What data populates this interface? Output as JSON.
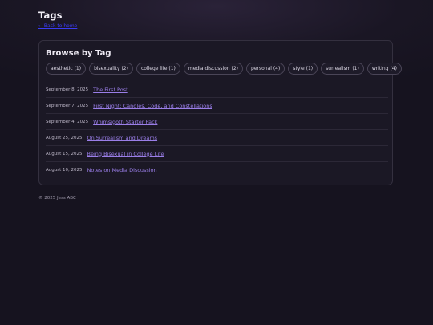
{
  "header": {
    "title": "Tags",
    "back_link": "← Back to home"
  },
  "browse": {
    "title": "Browse by Tag",
    "tags": [
      {
        "label": "aesthetic (1)"
      },
      {
        "label": "bisexuality (2)"
      },
      {
        "label": "college life (1)"
      },
      {
        "label": "media discussion (2)"
      },
      {
        "label": "personal (4)"
      },
      {
        "label": "style (1)"
      },
      {
        "label": "surrealism (1)"
      },
      {
        "label": "writing (4)"
      }
    ],
    "posts": [
      {
        "date": "September 8, 2025",
        "title": "The First Post"
      },
      {
        "date": "September 7, 2025",
        "title": "First Night: Candles, Code, and Constellations"
      },
      {
        "date": "September 4, 2025",
        "title": "Whimsigoth Starter Pack"
      },
      {
        "date": "August 25, 2025",
        "title": "On Surrealism and Dreams"
      },
      {
        "date": "August 15, 2025",
        "title": "Being Bisexual in College Life"
      },
      {
        "date": "August 10, 2025",
        "title": "Notes on Media Discussion"
      }
    ]
  },
  "footer": {
    "copyright": "© 2025 Jess ABC"
  },
  "colors": {
    "background": "#16131f",
    "card": "#1b1825",
    "link": "#9a7ee8",
    "back_link": "#3b3bf5"
  }
}
